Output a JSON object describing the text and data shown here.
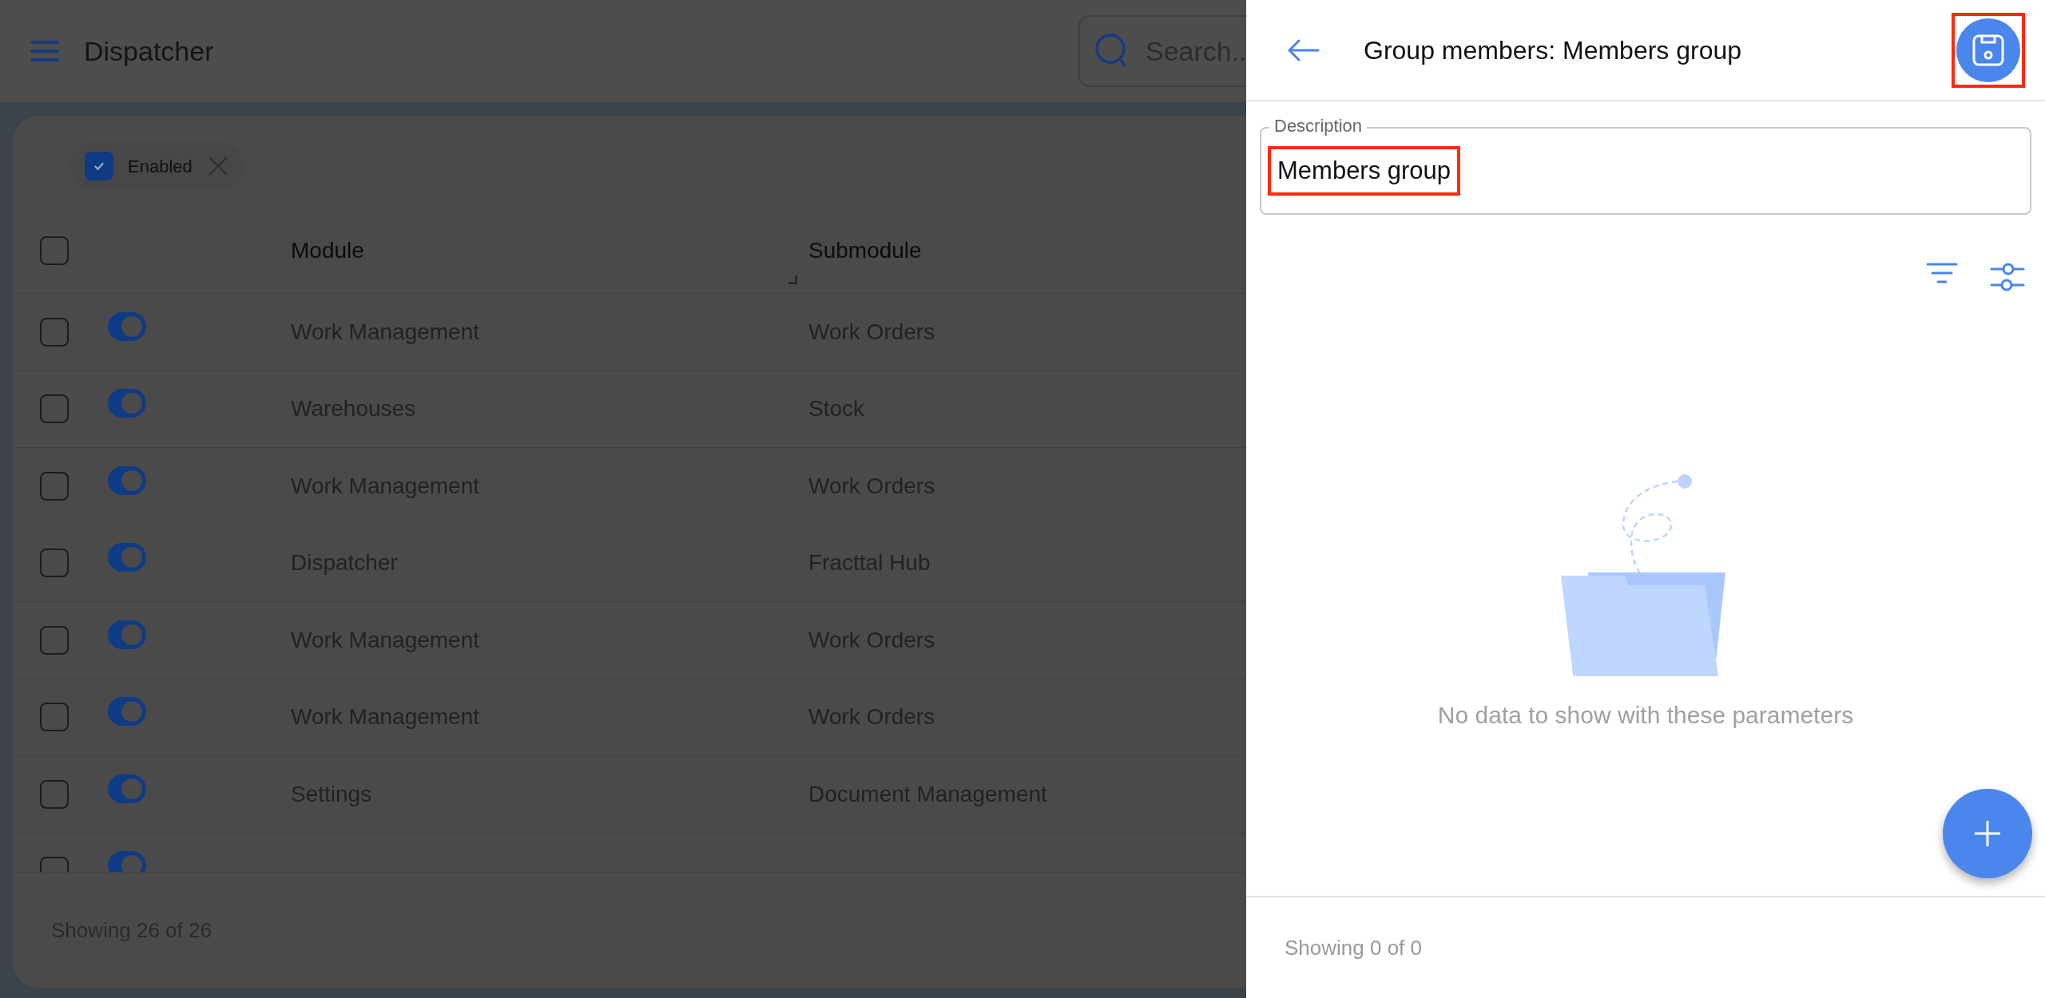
{
  "app_bar": {
    "title": "Dispatcher",
    "search": {
      "placeholder": "Search..."
    }
  },
  "filter_chip": {
    "label": "Enabled",
    "checked": true
  },
  "table": {
    "select_all": {
      "checked": false
    },
    "columns": [
      "Module",
      "Submodule"
    ],
    "rows": [
      {
        "checked": false,
        "on": true,
        "module": "Work Management",
        "submodule": "Work Orders"
      },
      {
        "checked": false,
        "on": true,
        "module": "Warehouses",
        "submodule": "Stock"
      },
      {
        "checked": false,
        "on": true,
        "module": "Work Management",
        "submodule": "Work Orders"
      },
      {
        "checked": false,
        "on": true,
        "module": "Dispatcher",
        "submodule": "Fracttal Hub"
      },
      {
        "checked": false,
        "on": true,
        "module": "Work Management",
        "submodule": "Work Orders"
      },
      {
        "checked": false,
        "on": true,
        "module": "Work Management",
        "submodule": "Work Orders"
      },
      {
        "checked": false,
        "on": true,
        "module": "Settings",
        "submodule": "Document Management"
      },
      {
        "checked": false,
        "on": true
      }
    ],
    "footer": "Showing 26 of 26"
  },
  "panel": {
    "title": "Group members: Members group",
    "save_highlighted": true,
    "description": {
      "label": "Description",
      "value": "Members group",
      "highlighted": true
    },
    "empty_message": "No data to show with these parameters",
    "footer": "Showing 0 of 0"
  }
}
